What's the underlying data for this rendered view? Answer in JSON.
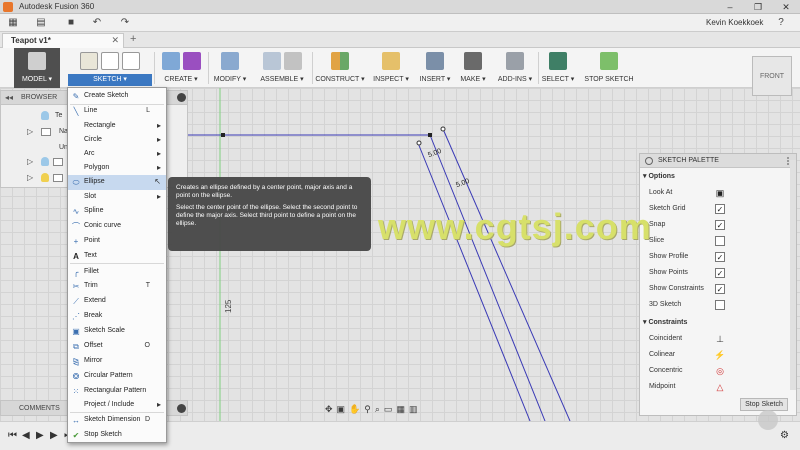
{
  "window": {
    "title": "Autodesk Fusion 360",
    "user": "Kevin Koekkoek"
  },
  "tabs": {
    "doc_tab": "Teapot v1*"
  },
  "ribbon": {
    "groups": [
      "MODEL ▾",
      "SKETCH ▾",
      "CREATE ▾",
      "MODIFY ▾",
      "ASSEMBLE ▾",
      "CONSTRUCT ▾",
      "INSPECT ▾",
      "INSERT ▾",
      "MAKE ▾",
      "ADD-INS ▾",
      "SELECT ▾",
      "STOP SKETCH"
    ]
  },
  "viewcube": {
    "label": "FRONT"
  },
  "browser": {
    "title": "BROWSER",
    "rows": [
      "Te",
      "Nar",
      "Uni",
      "",
      "",
      ""
    ]
  },
  "comments": {
    "title": "COMMENTS"
  },
  "sketch_menu": {
    "items": [
      {
        "label": "Create Sketch",
        "shortcut": "",
        "sub": ""
      },
      {
        "label": "Line",
        "shortcut": "L",
        "sub": ""
      },
      {
        "label": "Rectangle",
        "shortcut": "",
        "sub": "▸"
      },
      {
        "label": "Circle",
        "shortcut": "",
        "sub": "▸"
      },
      {
        "label": "Arc",
        "shortcut": "",
        "sub": "▸"
      },
      {
        "label": "Polygon",
        "shortcut": "",
        "sub": "▸"
      },
      {
        "label": "Ellipse",
        "shortcut": "",
        "sub": ""
      },
      {
        "label": "Slot",
        "shortcut": "",
        "sub": "▸"
      },
      {
        "label": "Spline",
        "shortcut": "",
        "sub": ""
      },
      {
        "label": "Conic curve",
        "shortcut": "",
        "sub": ""
      },
      {
        "label": "Point",
        "shortcut": "",
        "sub": ""
      },
      {
        "label": "Text",
        "shortcut": "",
        "sub": ""
      },
      {
        "label": "Fillet",
        "shortcut": "",
        "sub": ""
      },
      {
        "label": "Trim",
        "shortcut": "T",
        "sub": ""
      },
      {
        "label": "Extend",
        "shortcut": "",
        "sub": ""
      },
      {
        "label": "Break",
        "shortcut": "",
        "sub": ""
      },
      {
        "label": "Sketch Scale",
        "shortcut": "",
        "sub": ""
      },
      {
        "label": "Offset",
        "shortcut": "O",
        "sub": ""
      },
      {
        "label": "Mirror",
        "shortcut": "",
        "sub": ""
      },
      {
        "label": "Circular Pattern",
        "shortcut": "",
        "sub": ""
      },
      {
        "label": "Rectangular Pattern",
        "shortcut": "",
        "sub": ""
      },
      {
        "label": "Project / Include",
        "shortcut": "",
        "sub": "▸"
      },
      {
        "label": "Sketch Dimension",
        "shortcut": "D",
        "sub": ""
      },
      {
        "label": "Stop Sketch",
        "shortcut": "",
        "sub": ""
      }
    ]
  },
  "tooltip": {
    "line1": "Creates an ellipse defined by a center point, major axis and a point on the ellipse.",
    "line2": "Select the center point of the ellipse. Select the second point to define the major axis. Select third point to define a point on the ellipse."
  },
  "canvas": {
    "dim_vertical": "125",
    "dim_a": "5.00",
    "dim_b": "5.00"
  },
  "palette": {
    "title": "SKETCH PALETTE",
    "options_title": "Options",
    "options": [
      {
        "label": "Look At",
        "checked": ""
      },
      {
        "label": "Sketch Grid",
        "checked": "✓"
      },
      {
        "label": "Snap",
        "checked": "✓"
      },
      {
        "label": "Slice",
        "checked": ""
      },
      {
        "label": "Show Profile",
        "checked": "✓"
      },
      {
        "label": "Show Points",
        "checked": "✓"
      },
      {
        "label": "Show Constraints",
        "checked": "✓"
      },
      {
        "label": "3D Sketch",
        "checked": ""
      }
    ],
    "constraints_title": "Constraints",
    "constraints": [
      {
        "label": "Coincident",
        "icon": "⊥"
      },
      {
        "label": "Colinear",
        "icon": "⚡"
      },
      {
        "label": "Concentric",
        "icon": "◎"
      },
      {
        "label": "Midpoint",
        "icon": "△"
      }
    ],
    "stop_button": "Stop Sketch"
  },
  "watermark": {
    "text": "www.cgtsj.com"
  },
  "colors": {
    "accent": "#3b78c2",
    "sketch_line": "#3a3ab5",
    "tooltip_bg": "#484848"
  }
}
